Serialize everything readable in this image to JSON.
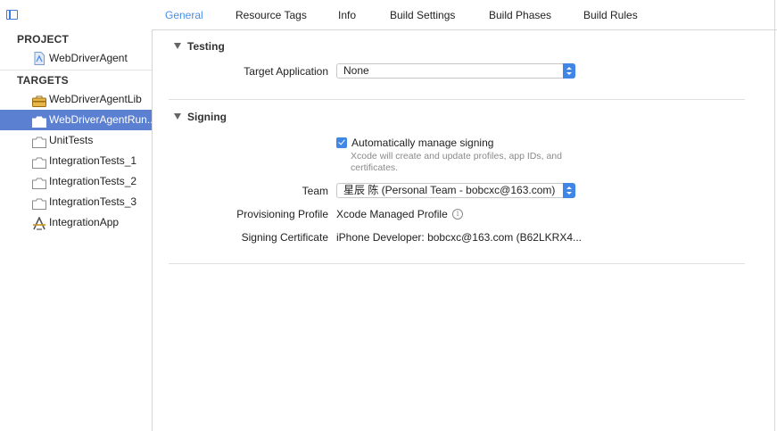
{
  "tabs": [
    {
      "label": "General",
      "active": true
    },
    {
      "label": "Resource Tags"
    },
    {
      "label": "Info"
    },
    {
      "label": "Build Settings"
    },
    {
      "label": "Build Phases"
    },
    {
      "label": "Build Rules"
    }
  ],
  "sidebar": {
    "project_header": "PROJECT",
    "project": {
      "label": "WebDriverAgent",
      "icon": "project-file-icon"
    },
    "targets_header": "TARGETS",
    "targets": [
      {
        "label": "WebDriverAgentLib",
        "icon": "framework-toolbox-icon"
      },
      {
        "label": "WebDriverAgentRun...",
        "icon": "test-bundle-icon",
        "selected": true
      },
      {
        "label": "UnitTests",
        "icon": "test-bundle-icon"
      },
      {
        "label": "IntegrationTests_1",
        "icon": "test-bundle-icon"
      },
      {
        "label": "IntegrationTests_2",
        "icon": "test-bundle-icon"
      },
      {
        "label": "IntegrationTests_3",
        "icon": "test-bundle-icon"
      },
      {
        "label": "IntegrationApp",
        "icon": "app-icon"
      }
    ]
  },
  "testing": {
    "title": "Testing",
    "target_app_label": "Target Application",
    "target_app_value": "None"
  },
  "signing": {
    "title": "Signing",
    "auto_manage_label": "Automatically manage signing",
    "auto_manage_checked": true,
    "help_text": "Xcode will create and update profiles, app IDs, and certificates.",
    "team_label": "Team",
    "team_value": "星辰 陈 (Personal Team - bobcxc@163.com)",
    "profile_label": "Provisioning Profile",
    "profile_value": "Xcode Managed Profile",
    "cert_label": "Signing Certificate",
    "cert_value": "iPhone Developer: bobcxc@163.com (B62LKRX4..."
  },
  "colors": {
    "accent": "#3f86e6",
    "selection": "#5b7fd1",
    "active_tab": "#4a8ee6"
  }
}
